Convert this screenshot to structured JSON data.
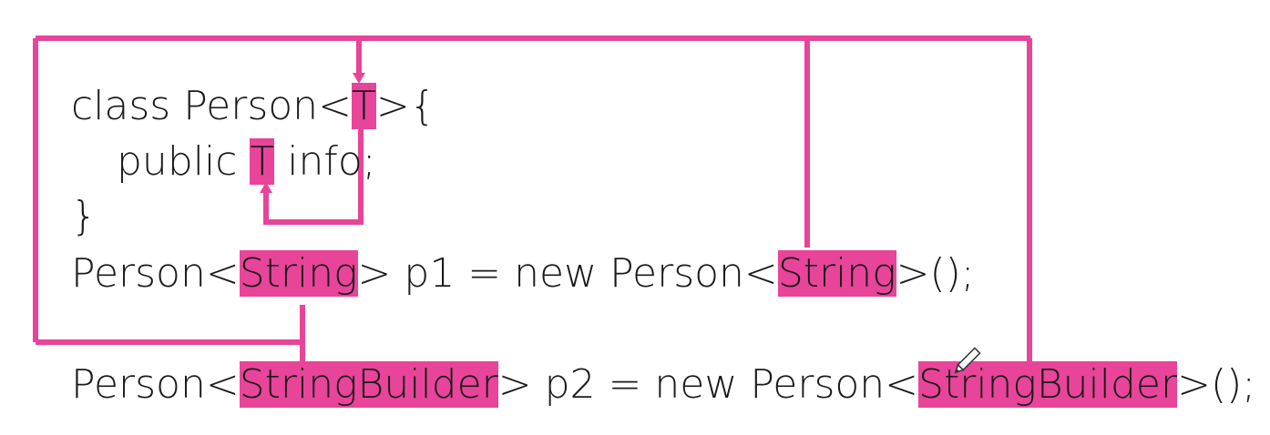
{
  "highlight_color": "#e8449a",
  "code": {
    "line1": {
      "before": "class Person<",
      "param": "T",
      "after": ">{"
    },
    "line2": {
      "before": "public ",
      "param": "T",
      "after": " info;"
    },
    "line3": {
      "text": "}"
    },
    "line4": {
      "before": "Person<",
      "arg1": "String",
      "mid": "> p1 = new Person<",
      "arg2": "String",
      "after": ">();"
    },
    "line5": {
      "before": "Person<",
      "arg1": "StringBuilder",
      "mid": "> p2 = new Person<",
      "arg2": "StringBuilder",
      "after": ">();"
    }
  },
  "cursor_icon": "pencil-icon"
}
